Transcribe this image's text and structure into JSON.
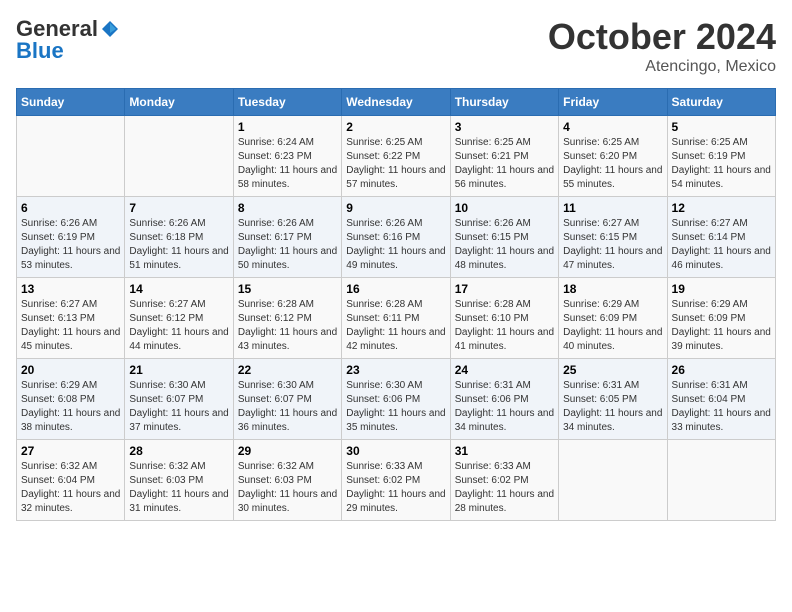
{
  "logo": {
    "general": "General",
    "blue": "Blue"
  },
  "month": "October 2024",
  "location": "Atencingo, Mexico",
  "days_of_week": [
    "Sunday",
    "Monday",
    "Tuesday",
    "Wednesday",
    "Thursday",
    "Friday",
    "Saturday"
  ],
  "weeks": [
    [
      {
        "day": "",
        "info": ""
      },
      {
        "day": "",
        "info": ""
      },
      {
        "day": "1",
        "sunrise": "6:24 AM",
        "sunset": "6:23 PM",
        "daylight": "11 hours and 58 minutes."
      },
      {
        "day": "2",
        "sunrise": "6:25 AM",
        "sunset": "6:22 PM",
        "daylight": "11 hours and 57 minutes."
      },
      {
        "day": "3",
        "sunrise": "6:25 AM",
        "sunset": "6:21 PM",
        "daylight": "11 hours and 56 minutes."
      },
      {
        "day": "4",
        "sunrise": "6:25 AM",
        "sunset": "6:20 PM",
        "daylight": "11 hours and 55 minutes."
      },
      {
        "day": "5",
        "sunrise": "6:25 AM",
        "sunset": "6:19 PM",
        "daylight": "11 hours and 54 minutes."
      }
    ],
    [
      {
        "day": "6",
        "sunrise": "6:26 AM",
        "sunset": "6:19 PM",
        "daylight": "11 hours and 53 minutes."
      },
      {
        "day": "7",
        "sunrise": "6:26 AM",
        "sunset": "6:18 PM",
        "daylight": "11 hours and 51 minutes."
      },
      {
        "day": "8",
        "sunrise": "6:26 AM",
        "sunset": "6:17 PM",
        "daylight": "11 hours and 50 minutes."
      },
      {
        "day": "9",
        "sunrise": "6:26 AM",
        "sunset": "6:16 PM",
        "daylight": "11 hours and 49 minutes."
      },
      {
        "day": "10",
        "sunrise": "6:26 AM",
        "sunset": "6:15 PM",
        "daylight": "11 hours and 48 minutes."
      },
      {
        "day": "11",
        "sunrise": "6:27 AM",
        "sunset": "6:15 PM",
        "daylight": "11 hours and 47 minutes."
      },
      {
        "day": "12",
        "sunrise": "6:27 AM",
        "sunset": "6:14 PM",
        "daylight": "11 hours and 46 minutes."
      }
    ],
    [
      {
        "day": "13",
        "sunrise": "6:27 AM",
        "sunset": "6:13 PM",
        "daylight": "11 hours and 45 minutes."
      },
      {
        "day": "14",
        "sunrise": "6:27 AM",
        "sunset": "6:12 PM",
        "daylight": "11 hours and 44 minutes."
      },
      {
        "day": "15",
        "sunrise": "6:28 AM",
        "sunset": "6:12 PM",
        "daylight": "11 hours and 43 minutes."
      },
      {
        "day": "16",
        "sunrise": "6:28 AM",
        "sunset": "6:11 PM",
        "daylight": "11 hours and 42 minutes."
      },
      {
        "day": "17",
        "sunrise": "6:28 AM",
        "sunset": "6:10 PM",
        "daylight": "11 hours and 41 minutes."
      },
      {
        "day": "18",
        "sunrise": "6:29 AM",
        "sunset": "6:09 PM",
        "daylight": "11 hours and 40 minutes."
      },
      {
        "day": "19",
        "sunrise": "6:29 AM",
        "sunset": "6:09 PM",
        "daylight": "11 hours and 39 minutes."
      }
    ],
    [
      {
        "day": "20",
        "sunrise": "6:29 AM",
        "sunset": "6:08 PM",
        "daylight": "11 hours and 38 minutes."
      },
      {
        "day": "21",
        "sunrise": "6:30 AM",
        "sunset": "6:07 PM",
        "daylight": "11 hours and 37 minutes."
      },
      {
        "day": "22",
        "sunrise": "6:30 AM",
        "sunset": "6:07 PM",
        "daylight": "11 hours and 36 minutes."
      },
      {
        "day": "23",
        "sunrise": "6:30 AM",
        "sunset": "6:06 PM",
        "daylight": "11 hours and 35 minutes."
      },
      {
        "day": "24",
        "sunrise": "6:31 AM",
        "sunset": "6:06 PM",
        "daylight": "11 hours and 34 minutes."
      },
      {
        "day": "25",
        "sunrise": "6:31 AM",
        "sunset": "6:05 PM",
        "daylight": "11 hours and 34 minutes."
      },
      {
        "day": "26",
        "sunrise": "6:31 AM",
        "sunset": "6:04 PM",
        "daylight": "11 hours and 33 minutes."
      }
    ],
    [
      {
        "day": "27",
        "sunrise": "6:32 AM",
        "sunset": "6:04 PM",
        "daylight": "11 hours and 32 minutes."
      },
      {
        "day": "28",
        "sunrise": "6:32 AM",
        "sunset": "6:03 PM",
        "daylight": "11 hours and 31 minutes."
      },
      {
        "day": "29",
        "sunrise": "6:32 AM",
        "sunset": "6:03 PM",
        "daylight": "11 hours and 30 minutes."
      },
      {
        "day": "30",
        "sunrise": "6:33 AM",
        "sunset": "6:02 PM",
        "daylight": "11 hours and 29 minutes."
      },
      {
        "day": "31",
        "sunrise": "6:33 AM",
        "sunset": "6:02 PM",
        "daylight": "11 hours and 28 minutes."
      },
      {
        "day": "",
        "info": ""
      },
      {
        "day": "",
        "info": ""
      }
    ]
  ],
  "labels": {
    "sunrise_prefix": "Sunrise: ",
    "sunset_prefix": "Sunset: ",
    "daylight_prefix": "Daylight: "
  }
}
